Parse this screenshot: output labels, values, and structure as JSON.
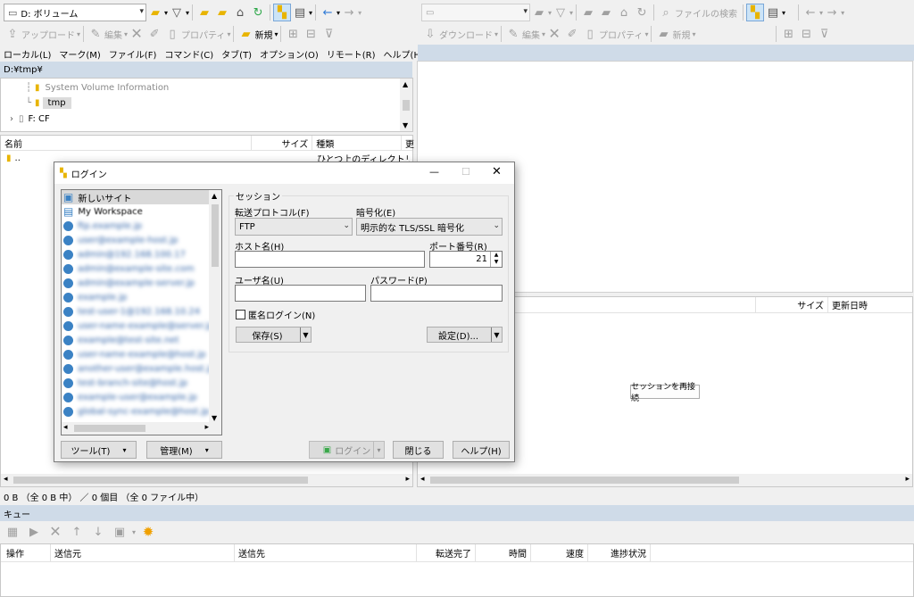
{
  "left_toolbar": {
    "drive_label": "D: ボリューム",
    "upload": "アップロード",
    "edit": "編集",
    "properties": "プロパティ",
    "new": "新規"
  },
  "right_toolbar": {
    "search": "ファイルの検索",
    "download": "ダウンロード",
    "edit": "編集",
    "properties": "プロパティ",
    "new": "新規"
  },
  "menu": [
    "ローカル(L)",
    "マーク(M)",
    "ファイル(F)",
    "コマンド(C)",
    "タブ(T)",
    "オプション(O)",
    "リモート(R)",
    "ヘルプ(H)"
  ],
  "local_path": "D:¥tmp¥",
  "tree": {
    "items": [
      {
        "label": "System Volume Information",
        "dim": true
      },
      {
        "label": "tmp",
        "selected": true
      },
      {
        "label": "F: CF",
        "drive": true
      }
    ]
  },
  "local_list": {
    "headers": [
      "名前",
      "サイズ",
      "種類",
      "更"
    ],
    "rows": [
      {
        "name": "..",
        "type": "ひとつ上のディレクトリ"
      }
    ]
  },
  "local_status": "0 B （全 0 B 中） ／ 0 個目 （全 0 ファイル中）",
  "remote_list": {
    "headers": [
      "サイズ",
      "更新日時"
    ],
    "reconnect": "セッションを再接続"
  },
  "queue": {
    "title": "キュー",
    "headers": [
      "操作",
      "送信元",
      "送信先",
      "転送完了",
      "時間",
      "速度",
      "進捗状況"
    ]
  },
  "login_dialog": {
    "title": "ログイン",
    "sites": [
      {
        "label": "新しいサイト",
        "type": "new"
      },
      {
        "label": "My Workspace",
        "type": "workspace"
      },
      {
        "label": "ftp.example.jp",
        "type": "site"
      },
      {
        "label": "user@example-host.jp",
        "type": "site"
      },
      {
        "label": "admin@192.168.100.17",
        "type": "site"
      },
      {
        "label": "admin@example-site.com",
        "type": "site"
      },
      {
        "label": "admin@example-server.jp",
        "type": "site"
      },
      {
        "label": "example.jp",
        "type": "site"
      },
      {
        "label": "test-user-1@192.168.10.24",
        "type": "site"
      },
      {
        "label": "user-name-example@server.jp",
        "type": "site"
      },
      {
        "label": "example@test-site.net",
        "type": "site"
      },
      {
        "label": "user-name-example@host.jp",
        "type": "site"
      },
      {
        "label": "another-user@example.host.jp",
        "type": "site"
      },
      {
        "label": "test-branch-site@host.jp",
        "type": "site"
      },
      {
        "label": "example-user@example.jp",
        "type": "site"
      },
      {
        "label": "global-sync-example@host.jp",
        "type": "site"
      }
    ],
    "tools_button": "ツール(T)",
    "manage_button": "管理(M)",
    "session_label": "セッション",
    "protocol_label": "転送プロトコル(F)",
    "protocol_value": "FTP",
    "encryption_label": "暗号化(E)",
    "encryption_value": "明示的な TLS/SSL 暗号化",
    "host_label": "ホスト名(H)",
    "host_value": "",
    "port_label": "ポート番号(R)",
    "port_value": "21",
    "user_label": "ユーザ名(U)",
    "user_value": "",
    "password_label": "パスワード(P)",
    "password_value": "",
    "anonymous_label": "匿名ログイン(N)",
    "save_button": "保存(S)",
    "settings_button": "設定(D)...",
    "login_button": "ログイン",
    "close_button": "閉じる",
    "help_button": "ヘルプ(H)"
  },
  "colors": {
    "accent": "#cfdbe8",
    "selection": "#cce8ff",
    "folder": "#e8b400"
  }
}
